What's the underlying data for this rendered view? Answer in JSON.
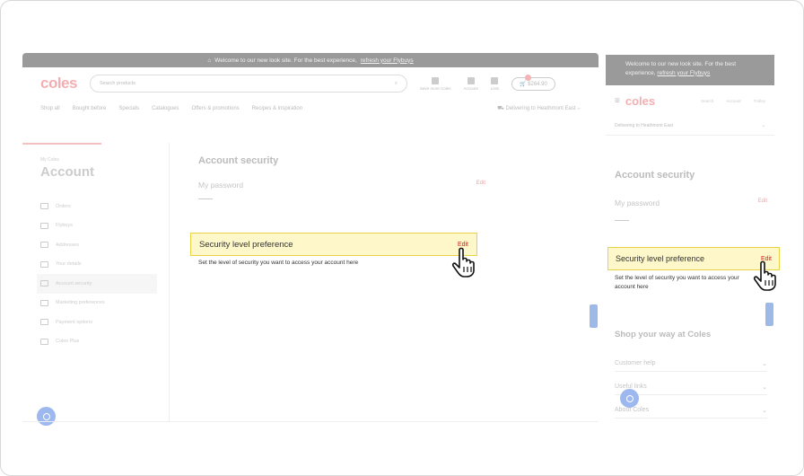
{
  "desktop": {
    "banner": {
      "text": "Welcome to our new look site. For the best experience,",
      "link": "refresh your Flybuys"
    },
    "logo": "coles",
    "search_placeholder": "Search products",
    "header_icons": [
      "Save more Coles",
      "Account",
      "Lists"
    ],
    "trolley_total": "$264.90",
    "nav": [
      "Shop all",
      "Bought before",
      "Specials",
      "Catalogues",
      "Offers & promotions",
      "Recipes & inspiration"
    ],
    "delivering_to": "Delivering to Heathmont East",
    "breadcrumb": "My Coles",
    "account_title": "Account",
    "menu": [
      "Orders",
      "Flybuys",
      "Addresses",
      "Your details",
      "Account security",
      "Marketing preferences",
      "Payment options",
      "Coles Plus"
    ],
    "page_title": "Account security",
    "password_label": "My password",
    "edit_label": "Edit",
    "security_pref_label": "Security level preference",
    "security_pref_desc": "Set the level of security you want to access your account here"
  },
  "mobile": {
    "banner": {
      "text": "Welcome to our new look site. For the best experience,",
      "link": "refresh your Flybuys"
    },
    "logo": "coles",
    "icons": [
      "Search",
      "Account",
      "Trolley"
    ],
    "delivering_to": "Delivering to Heathmont East",
    "page_title": "Account security",
    "password_label": "My password",
    "edit_label": "Edit",
    "security_pref_label": "Security level preference",
    "security_pref_desc": "Set the level of security you want to access your account here",
    "shop_heading": "Shop your way at Coles",
    "accordion": [
      "Customer help",
      "Useful links",
      "About Coles"
    ]
  },
  "colors": {
    "brand_red": "#e01a22",
    "highlight": "#fdf7c9",
    "highlight_border": "#e7d344"
  }
}
